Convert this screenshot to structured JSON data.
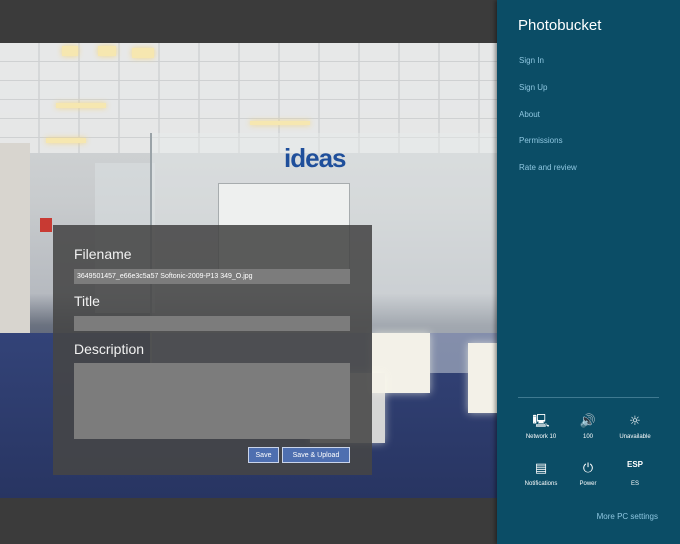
{
  "dialog": {
    "filename_label": "Filename",
    "filename_value": "3649501457_e66e3c5a57 Softonic-2009-P13 349_O.jpg",
    "title_label": "Title",
    "title_value": "",
    "description_label": "Description",
    "description_value": "",
    "save_label": "Save",
    "save_upload_label": "Save & Upload"
  },
  "photo": {
    "sign_text": "ideas"
  },
  "charm": {
    "title": "Photobucket",
    "links": [
      "Sign In",
      "Sign Up",
      "About",
      "Permissions",
      "Rate and review"
    ],
    "tiles": [
      {
        "icon": "network-icon",
        "glyph": "🖳",
        "label": "Network  10"
      },
      {
        "icon": "volume-icon",
        "glyph": "🔊",
        "label": "100"
      },
      {
        "icon": "brightness-icon",
        "glyph": "☼",
        "label": "Unavailable"
      },
      {
        "icon": "notifications-icon",
        "glyph": "▤",
        "label": "Notifications"
      },
      {
        "icon": "power-icon",
        "glyph": "⏻",
        "label": "Power"
      },
      {
        "icon": "keyboard-language-icon",
        "glyph": "ESP",
        "label": "ES"
      }
    ],
    "more_settings": "More PC settings"
  }
}
